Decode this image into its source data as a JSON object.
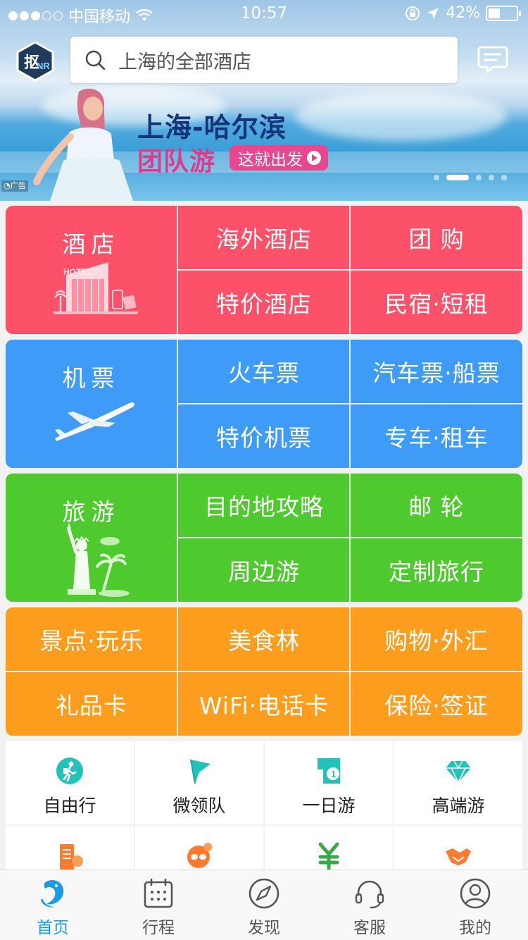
{
  "status_bar": {
    "carrier": "中国移动",
    "time": "10:57",
    "battery": "42%",
    "battery_level": 0.42
  },
  "search": {
    "placeholder": "上海的全部酒店"
  },
  "banner": {
    "title": "上海-哈尔滨",
    "subtitle": "团队游",
    "button": "这就出发",
    "ad_tag": "广告",
    "page_count": 5,
    "active_page": 1
  },
  "colors": {
    "hotel": "#fc5168",
    "flight": "#3e9bf8",
    "travel": "#4ec92e",
    "misc": "#fd9d1d",
    "accent": "#1a9be3"
  },
  "categories": {
    "hotel": {
      "main": "酒店",
      "cells": [
        "海外酒店",
        "团 购",
        "特价酒店",
        "民宿·短租"
      ]
    },
    "flight": {
      "main": "机票",
      "cells": [
        "火车票",
        "汽车票·船票",
        "特价机票",
        "专车·租车"
      ]
    },
    "travel": {
      "main": "旅游",
      "cells": [
        "目的地攻略",
        "邮 轮",
        "周边游",
        "定制旅行"
      ]
    },
    "misc": {
      "cells": [
        "景点·玩乐",
        "美食林",
        "购物·外汇",
        "礼品卡",
        "WiFi·电话卡",
        "保险·签证"
      ]
    }
  },
  "quick_links": [
    {
      "label": "自由行",
      "icon": "hiker-icon"
    },
    {
      "label": "微领队",
      "icon": "flag-icon"
    },
    {
      "label": "一日游",
      "icon": "one-day-flag-icon"
    },
    {
      "label": "高端游",
      "icon": "diamond-icon"
    }
  ],
  "quick_links_row2_icons": [
    "building-icon",
    "face-icon",
    "yuan-icon",
    "handshake-icon"
  ],
  "tabs": [
    {
      "label": "首页",
      "icon": "dolphin-home-icon",
      "active": true
    },
    {
      "label": "行程",
      "icon": "calendar-icon",
      "active": false
    },
    {
      "label": "发现",
      "icon": "compass-icon",
      "active": false
    },
    {
      "label": "客服",
      "icon": "headset-icon",
      "active": false
    },
    {
      "label": "我的",
      "icon": "person-icon",
      "active": false
    }
  ]
}
